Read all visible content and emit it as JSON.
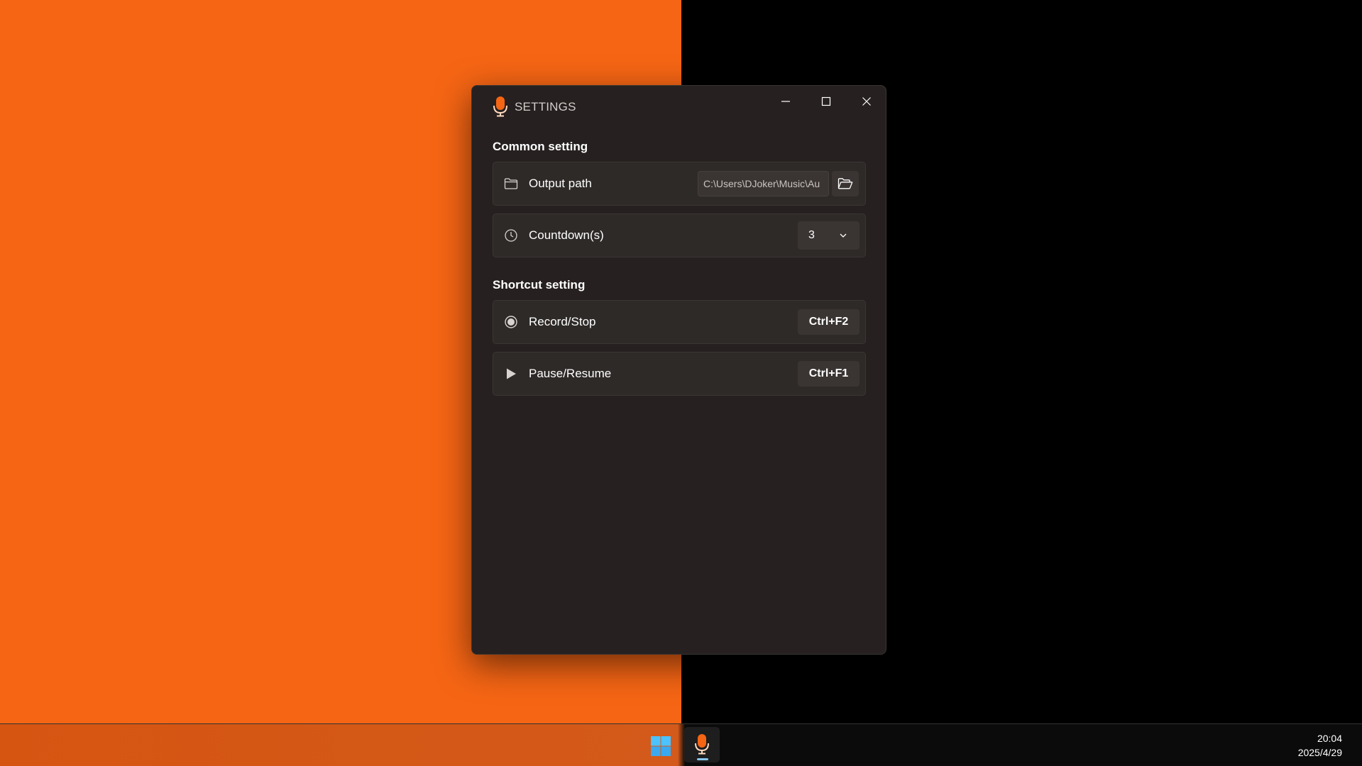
{
  "window": {
    "title": "SETTINGS",
    "icon": "microphone-icon",
    "accent_color": "#f56514"
  },
  "common": {
    "section_title": "Common setting",
    "output_path": {
      "label": "Output path",
      "icon": "folder-icon",
      "value": "C:\\Users\\DJoker\\Music\\Au",
      "browse_icon": "folder-open-icon"
    },
    "countdown": {
      "label": "Countdown(s)",
      "icon": "clock-icon",
      "value": "3"
    }
  },
  "shortcut": {
    "section_title": "Shortcut setting",
    "record": {
      "label": "Record/Stop",
      "icon": "record-icon",
      "key": "Ctrl+F2"
    },
    "pause": {
      "label": "Pause/Resume",
      "icon": "play-icon",
      "key": "Ctrl+F1"
    }
  },
  "taskbar": {
    "time": "20:04",
    "date": "2025/4/29"
  }
}
